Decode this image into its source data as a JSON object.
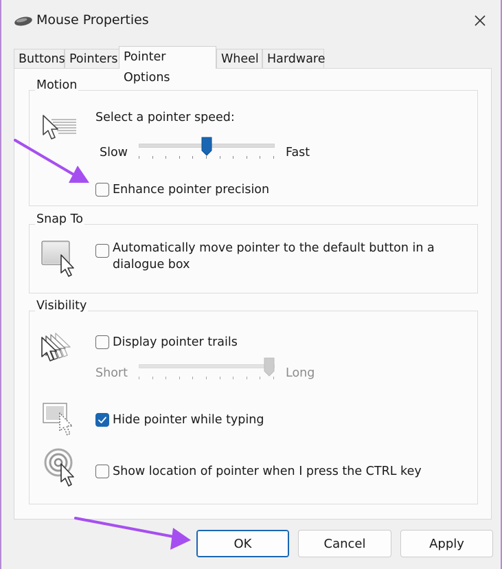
{
  "window": {
    "title": "Mouse Properties",
    "close_label": "✕"
  },
  "tabs": [
    {
      "label": "Buttons",
      "active": false
    },
    {
      "label": "Pointers",
      "active": false
    },
    {
      "label": "Pointer Options",
      "active": true
    },
    {
      "label": "Wheel",
      "active": false
    },
    {
      "label": "Hardware",
      "active": false
    }
  ],
  "motion": {
    "group_label": "Motion",
    "speed_label": "Select a pointer speed:",
    "slow_label": "Slow",
    "fast_label": "Fast",
    "speed_level": 0.5,
    "precision_label": "Enhance pointer precision",
    "precision_checked": false
  },
  "snap_to": {
    "group_label": "Snap To",
    "auto_move_label_line1": "Automatically move pointer to the default button in a",
    "auto_move_label_line2": "dialogue box",
    "auto_move_checked": false
  },
  "visibility": {
    "group_label": "Visibility",
    "trails_label": "Display pointer trails",
    "trails_checked": false,
    "short_label": "Short",
    "long_label": "Long",
    "trails_level": 1.0,
    "hide_typing_label": "Hide pointer while typing",
    "hide_typing_checked": true,
    "show_location_label": "Show location of pointer when I press the CTRL key",
    "show_location_checked": false
  },
  "buttons": {
    "ok": "OK",
    "cancel": "Cancel",
    "apply": "Apply"
  },
  "colors": {
    "accent": "#1a66b3",
    "annotation_arrow": "#a64ff0"
  }
}
